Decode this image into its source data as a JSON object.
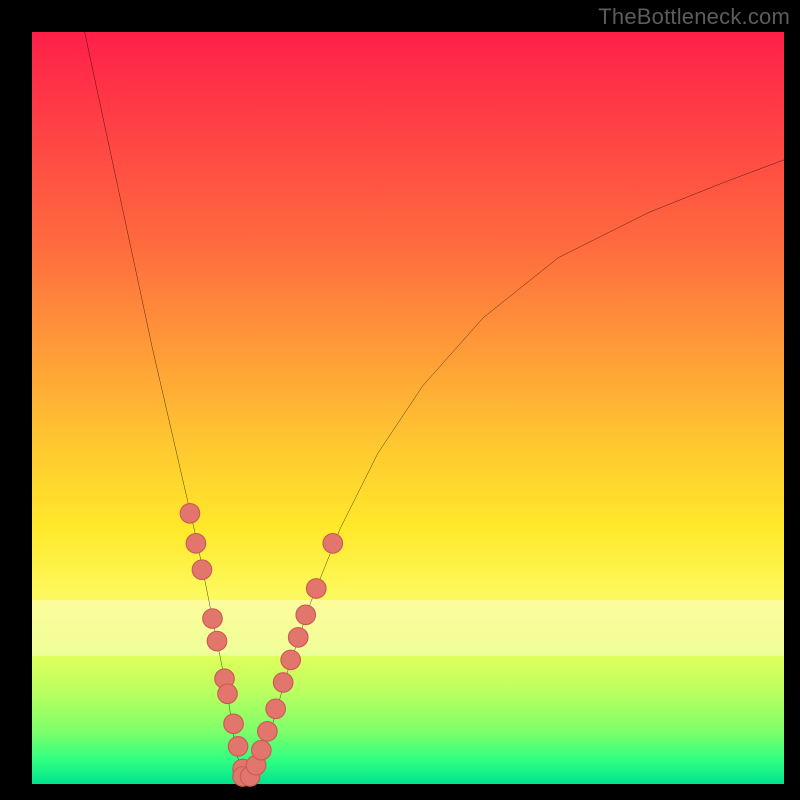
{
  "watermark": "TheBottleneck.com",
  "colors": {
    "frame": "#000000",
    "curve_stroke": "#000000",
    "marker_fill": "#e2766d",
    "marker_stroke": "#c95a52",
    "gradient_top": "#ff1f48",
    "gradient_bottom": "#00e38d",
    "band": "rgba(255,255,240,0.42)"
  },
  "chart_data": {
    "type": "line",
    "title": "",
    "xlabel": "",
    "ylabel": "",
    "xlim": [
      0,
      100
    ],
    "ylim": [
      0,
      100
    ],
    "grid": false,
    "legend": false,
    "note": "Curve drops steeply from top-left to a minimum near x≈28, y≈0, then rises with decreasing slope toward the top-right edge near x≈100, y≈83. Background is a red→yellow→green vertical gradient with a faint light band around y≈20–28. Salmon markers cluster along the curve near the bottom of the V on both sides.",
    "series": [
      {
        "name": "curve",
        "x": [
          7,
          10,
          13,
          16,
          19,
          22,
          24,
          26,
          27,
          28,
          29,
          30,
          32,
          34,
          37,
          41,
          46,
          52,
          60,
          70,
          82,
          92,
          100
        ],
        "y": [
          100,
          86,
          72,
          58,
          45,
          32,
          22,
          12,
          5,
          1,
          1,
          3,
          8,
          15,
          24,
          34,
          44,
          53,
          62,
          70,
          76,
          80,
          83
        ]
      }
    ],
    "markers": {
      "shape": "circle",
      "radius_pct": 1.3,
      "points": [
        {
          "x": 21.0,
          "y": 36.0
        },
        {
          "x": 21.8,
          "y": 32.0
        },
        {
          "x": 22.6,
          "y": 28.5
        },
        {
          "x": 24.0,
          "y": 22.0
        },
        {
          "x": 24.6,
          "y": 19.0
        },
        {
          "x": 25.6,
          "y": 14.0
        },
        {
          "x": 26.0,
          "y": 12.0
        },
        {
          "x": 26.8,
          "y": 8.0
        },
        {
          "x": 27.4,
          "y": 5.0
        },
        {
          "x": 28.0,
          "y": 2.0
        },
        {
          "x": 28.0,
          "y": 1.0
        },
        {
          "x": 29.0,
          "y": 1.0
        },
        {
          "x": 29.8,
          "y": 2.5
        },
        {
          "x": 30.5,
          "y": 4.5
        },
        {
          "x": 31.3,
          "y": 7.0
        },
        {
          "x": 32.4,
          "y": 10.0
        },
        {
          "x": 33.4,
          "y": 13.5
        },
        {
          "x": 34.4,
          "y": 16.5
        },
        {
          "x": 35.4,
          "y": 19.5
        },
        {
          "x": 36.4,
          "y": 22.5
        },
        {
          "x": 37.8,
          "y": 26.0
        },
        {
          "x": 40.0,
          "y": 32.0
        }
      ]
    }
  }
}
